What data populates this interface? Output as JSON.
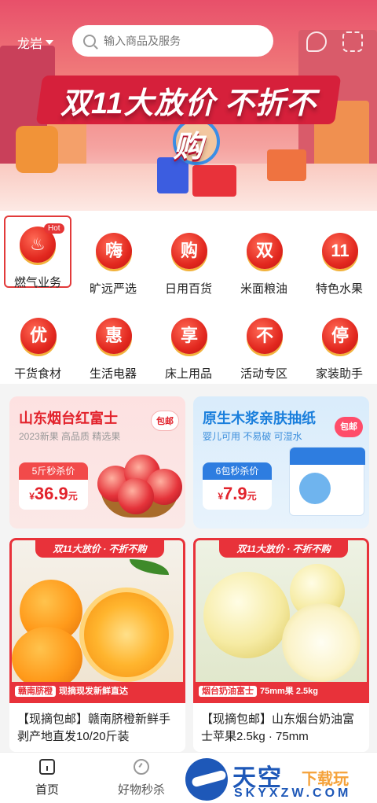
{
  "header": {
    "city": "龙岩",
    "search_placeholder": "输入商品及服务"
  },
  "banner": {
    "headline": "双11大放价 不折不购"
  },
  "categories": [
    {
      "label": "燃气业务",
      "glyph": "♨",
      "badge": "Hot",
      "selected": true
    },
    {
      "label": "旷远严选",
      "glyph": "嗨"
    },
    {
      "label": "日用百货",
      "glyph": "购"
    },
    {
      "label": "米面粮油",
      "glyph": "双"
    },
    {
      "label": "特色水果",
      "glyph": "11"
    },
    {
      "label": "干货食材",
      "glyph": "优"
    },
    {
      "label": "生活电器",
      "glyph": "惠"
    },
    {
      "label": "床上用品",
      "glyph": "享"
    },
    {
      "label": "活动专区",
      "glyph": "不"
    },
    {
      "label": "家装助手",
      "glyph": "停"
    }
  ],
  "promos": [
    {
      "title": "山东烟台红富士",
      "subtitle": "2023新果 高品质 精选果",
      "badge": "包邮",
      "price_label": "5斤秒杀价",
      "price_currency": "¥",
      "price_value": "36.9",
      "price_unit": "元"
    },
    {
      "title": "原生木浆亲肤抽纸",
      "subtitle": "婴儿可用 不易破 可湿水",
      "badge": "包邮",
      "price_label": "6包秒杀价",
      "price_currency": "¥",
      "price_value": "7.9",
      "price_unit": "元"
    }
  ],
  "products": [
    {
      "top_tag": "双11大放价 · 不折不购",
      "band_chip": "赣南脐橙",
      "band_text": "现摘现发新鲜直达",
      "name": "【现摘包邮】赣南脐橙新鲜手剥产地直发10/20斤装"
    },
    {
      "top_tag": "双11大放价 · 不折不购",
      "band_chip": "烟台奶油富士",
      "band_text": "75mm果 2.5kg",
      "name": "【现摘包邮】山东烟台奶油富士苹果2.5kg · 75mm"
    }
  ],
  "nav": [
    {
      "label": "首页",
      "icon": "home-icon"
    },
    {
      "label": "好物秒杀",
      "icon": "clock-icon"
    }
  ],
  "watermark": {
    "cn": "天空",
    "cn_accent": "下载玩",
    "en": "SKYXZW.COM"
  },
  "colors": {
    "brand_red": "#e8323a",
    "promo_blue": "#2e7de0"
  }
}
